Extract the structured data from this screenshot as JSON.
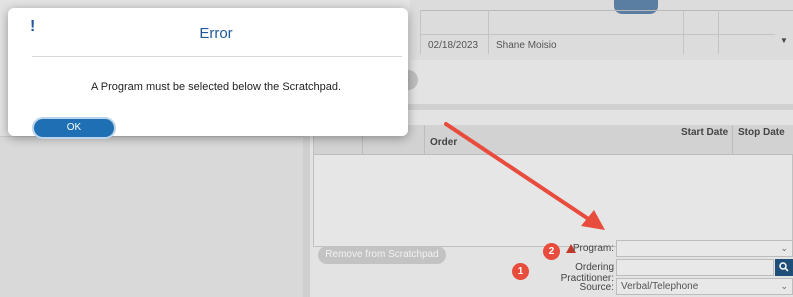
{
  "dialog": {
    "icon": "exclamation-icon",
    "title": "Error",
    "message": "A Program must be selected below the Scratchpad.",
    "ok_label": "OK"
  },
  "background_table": {
    "row": {
      "date": "02/18/2023",
      "name": "Shane Moisio"
    }
  },
  "order_grid": {
    "columns": [
      "Order",
      "Start Date",
      "Stop Date"
    ]
  },
  "form": {
    "remove_button": "Remove from Scratchpad",
    "program_label": "Program:",
    "program_value": "",
    "ordering_label": "Ordering Practitioner:",
    "ordering_value": "",
    "source_label": "Source:",
    "source_value": "Verbal/Telephone"
  },
  "annotations": {
    "badge_program": "2",
    "badge_ordering": "1",
    "badge_color": "#e74c3c",
    "arrow_color": "#e74c3c"
  },
  "colors": {
    "accent": "#1e6fb3",
    "search_button": "#1f4e79",
    "warning": "#c0392b"
  }
}
